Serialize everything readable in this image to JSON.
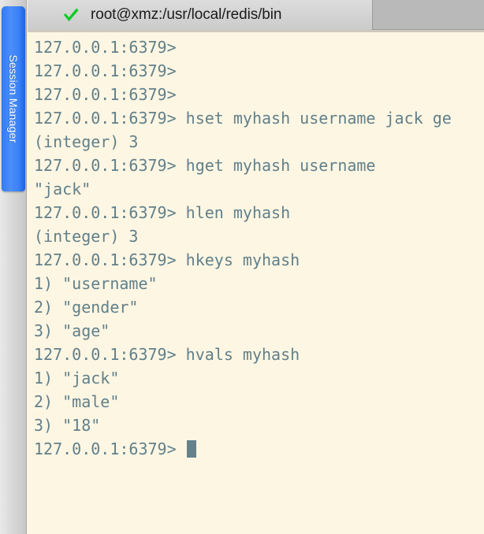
{
  "window": {
    "title": "root@xmz:/usr/local/redis/bin"
  },
  "sidebar": {
    "tab_label": "Session Manager",
    "tab_color": "#3a82f7",
    "background_color": "#dcdcdc"
  },
  "tabbar": {
    "status_icon": "green-check-icon",
    "status_icon_color": "#00cc22",
    "tab_title": "root@xmz:/usr/local/redis/bin",
    "background_color": "#b9b9b9",
    "active_tab_color": "#d3d3d3"
  },
  "terminal": {
    "background_color": "#fdf6e3",
    "text_color": "#61808a",
    "cursor_color": "#64818c",
    "prompt": "127.0.0.1:6379>",
    "font_size_px": 20,
    "line_height_px": 30,
    "lines": [
      {
        "text": "127.0.0.1:6379>",
        "type": "prompt"
      },
      {
        "text": "127.0.0.1:6379>",
        "type": "prompt"
      },
      {
        "text": "127.0.0.1:6379>",
        "type": "prompt"
      },
      {
        "text": "127.0.0.1:6379> hset myhash username jack ge",
        "type": "command"
      },
      {
        "text": "(integer) 3",
        "type": "output"
      },
      {
        "text": "127.0.0.1:6379> hget myhash username",
        "type": "command"
      },
      {
        "text": "\"jack\"",
        "type": "output"
      },
      {
        "text": "127.0.0.1:6379> hlen myhash",
        "type": "command"
      },
      {
        "text": "(integer) 3",
        "type": "output"
      },
      {
        "text": "127.0.0.1:6379> hkeys myhash",
        "type": "command"
      },
      {
        "text": "1) \"username\"",
        "type": "output"
      },
      {
        "text": "2) \"gender\"",
        "type": "output"
      },
      {
        "text": "3) \"age\"",
        "type": "output"
      },
      {
        "text": "127.0.0.1:6379> hvals myhash",
        "type": "command"
      },
      {
        "text": "1) \"jack\"",
        "type": "output"
      },
      {
        "text": "2) \"male\"",
        "type": "output"
      },
      {
        "text": "3) \"18\"",
        "type": "output"
      },
      {
        "text": "127.0.0.1:6379> ",
        "type": "prompt-active"
      }
    ]
  }
}
